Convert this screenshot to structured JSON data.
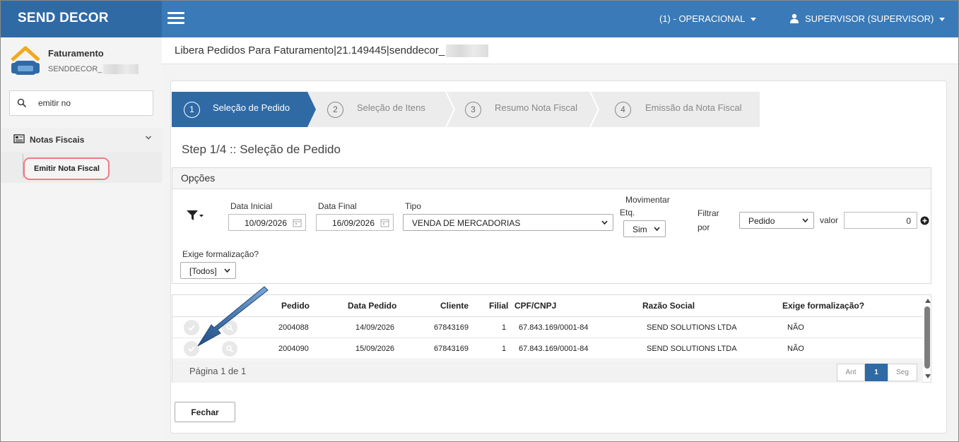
{
  "brand": "SEND DECOR",
  "topbar": {
    "profile_menu": "(1) - OPERACIONAL",
    "user_menu": "SUPERVISOR (SUPERVISOR)"
  },
  "sidebar": {
    "module_title": "Faturamento",
    "company": "SENDDECOR_",
    "search_value": "emitir no",
    "section": "Notas Fiscais",
    "item": "Emitir Nota Fiscal"
  },
  "page": {
    "title": "Libera Pedidos Para Faturamento|21.149445|senddecor_"
  },
  "wizard": {
    "steps": [
      {
        "num": "1",
        "label": "Seleção de Pedido",
        "active": true
      },
      {
        "num": "2",
        "label": "Seleção de Itens",
        "active": false
      },
      {
        "num": "3",
        "label": "Resumo Nota Fiscal",
        "active": false
      },
      {
        "num": "4",
        "label": "Emissão da Nota Fiscal",
        "active": false
      }
    ],
    "step_title": "Step 1/4 :: Seleção de Pedido"
  },
  "options": {
    "header": "Opções",
    "data_inicial_label": "Data Inicial",
    "data_inicial_value": "10/09/2026",
    "data_final_label": "Data Final",
    "data_final_value": "16/09/2026",
    "tipo_label": "Tipo",
    "tipo_value": "VENDA DE MERCADORIAS",
    "movimentar_label_1": "Movimentar",
    "movimentar_label_2": "Etq.",
    "movimentar_value": "Sim",
    "filtrar_label_1": "Filtrar",
    "filtrar_label_2": "por",
    "filtrar_value": "Pedido",
    "valor_label": "valor",
    "valor_value": "0",
    "exige_label": "Exige formalização?",
    "exige_value": "[Todos]"
  },
  "table": {
    "columns": [
      "Pedido",
      "Data Pedido",
      "Cliente",
      "Filial",
      "CPF/CNPJ",
      "Razão Social",
      "Exige formalização?"
    ],
    "rows": [
      [
        "2004088",
        "14/09/2026",
        "67843169",
        "1",
        "67.843.169/0001-84",
        "SEND SOLUTIONS LTDA",
        "NÃO"
      ],
      [
        "2004090",
        "15/09/2026",
        "67843169",
        "1",
        "67.843.169/0001-84",
        "SEND SOLUTIONS LTDA",
        "NÃO"
      ]
    ],
    "page_info": "Página 1 de 1",
    "pager": {
      "prev": "Ant",
      "current": "1",
      "next": "Seg"
    }
  },
  "buttons": {
    "close": "Fechar"
  },
  "colors": {
    "topbar": "#3a7ab8",
    "brand_bg": "#2f6aa5",
    "active_step": "#2f6aa5",
    "highlight": "#f07a84"
  }
}
